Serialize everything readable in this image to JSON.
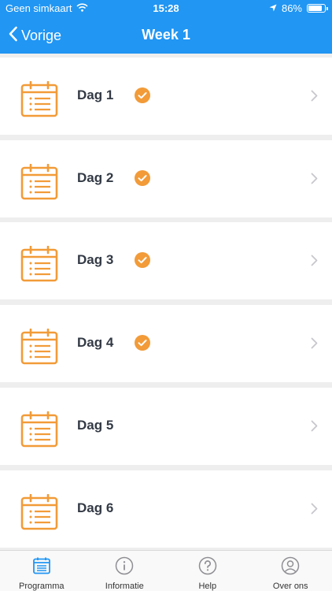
{
  "status": {
    "carrier": "Geen simkaart",
    "time": "15:28",
    "battery": "86%",
    "battery_level": 0.86
  },
  "nav": {
    "back_label": "Vorige",
    "title": "Week 1"
  },
  "days": [
    {
      "label": "Dag 1",
      "completed": true
    },
    {
      "label": "Dag 2",
      "completed": true
    },
    {
      "label": "Dag 3",
      "completed": true
    },
    {
      "label": "Dag 4",
      "completed": true
    },
    {
      "label": "Dag 5",
      "completed": false
    },
    {
      "label": "Dag 6",
      "completed": false
    }
  ],
  "tabs": [
    {
      "label": "Programma",
      "icon": "calendar-icon",
      "active": true
    },
    {
      "label": "Informatie",
      "icon": "info-icon",
      "active": false
    },
    {
      "label": "Help",
      "icon": "help-icon",
      "active": false
    },
    {
      "label": "Over ons",
      "icon": "person-icon",
      "active": false
    }
  ],
  "colors": {
    "primary": "#2196f3",
    "accent": "#f29b38",
    "text": "#333a45",
    "chevron": "#c7c7cc"
  }
}
